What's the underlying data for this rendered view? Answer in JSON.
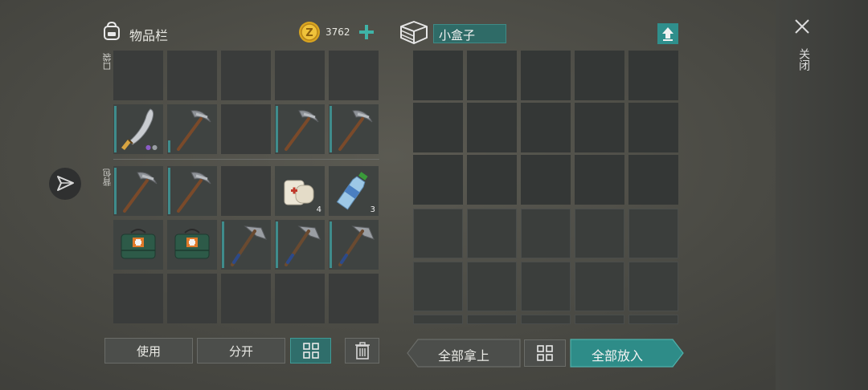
{
  "inventory": {
    "title": "物品栏",
    "icon": "backpack-icon",
    "coins": "3762",
    "coin_icon": "coin-icon",
    "pocket_label": "口袋",
    "backpack_label": "背包",
    "slots": [
      {
        "item": ""
      },
      {
        "item": ""
      },
      {
        "item": ""
      },
      {
        "item": ""
      },
      {
        "item": ""
      },
      {
        "item": "machete-icon",
        "bar": true,
        "dots": true
      },
      {
        "item": "pickaxe-icon",
        "bar": true,
        "bar_fill": 0.25
      },
      {
        "item": ""
      },
      {
        "item": "pickaxe-icon",
        "bar": true
      },
      {
        "item": "pickaxe-icon",
        "bar": true
      },
      {
        "item": "pickaxe-icon",
        "bar": true
      },
      {
        "item": "pickaxe-icon",
        "bar": true
      },
      {
        "item": ""
      },
      {
        "item": "bandage-icon",
        "qty": "4"
      },
      {
        "item": "water-bottle-icon",
        "qty": "3"
      },
      {
        "item": "first-aid-kit-icon"
      },
      {
        "item": "first-aid-kit-icon"
      },
      {
        "item": "hatchet-icon",
        "bar": true
      },
      {
        "item": "hatchet-icon",
        "bar": true
      },
      {
        "item": "hatchet-icon",
        "bar": true
      },
      {
        "item": ""
      },
      {
        "item": ""
      },
      {
        "item": ""
      },
      {
        "item": ""
      },
      {
        "item": ""
      }
    ]
  },
  "box": {
    "title": "小盒子",
    "icon": "box-icon",
    "upload_icon": "upload-arrow-icon"
  },
  "buttons": {
    "use": "使用",
    "split": "分开",
    "sort_icon": "grid-sort-icon",
    "trash_icon": "trash-icon",
    "take_all": "全部拿上",
    "put_all": "全部放入"
  },
  "close": {
    "icon": "close-icon",
    "label": "关闭"
  },
  "side_icon": "send-arrow-icon",
  "colors": {
    "accent": "#2f8f8c",
    "bar": "#3f8c8c",
    "coin": "#e6b52e"
  }
}
